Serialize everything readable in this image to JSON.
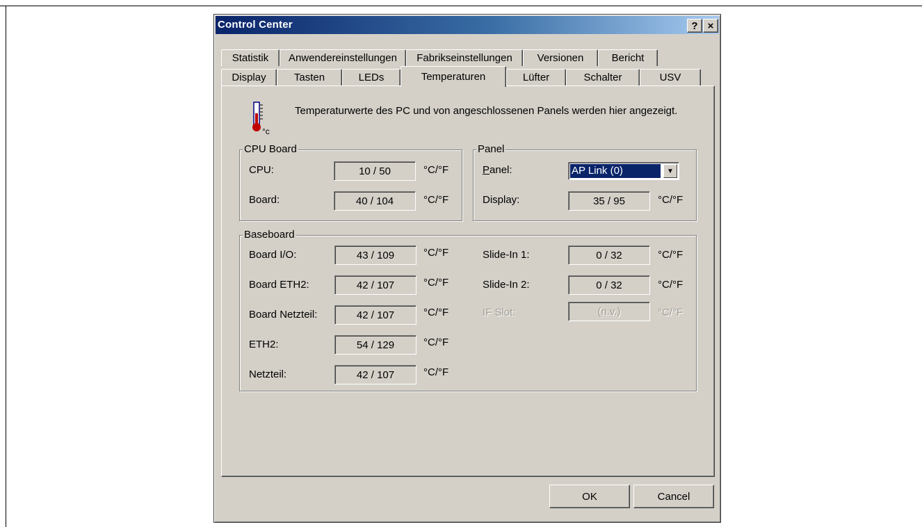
{
  "window": {
    "title": "Control Center",
    "help_glyph": "?",
    "close_glyph": "×"
  },
  "tabs": {
    "row1": [
      "Statistik",
      "Anwendereinstellungen",
      "Fabrikseinstellungen",
      "Versionen",
      "Bericht"
    ],
    "row2": [
      "Display",
      "Tasten",
      "LEDs",
      "Temperaturen",
      "Lüfter",
      "Schalter",
      "USV"
    ],
    "active": "Temperaturen"
  },
  "intro": {
    "icon": "thermometer-icon",
    "icon_unit": "°c",
    "text": "Temperaturwerte des PC und von angeschlossenen Panels werden hier angezeigt."
  },
  "unit_label": "°C/°F",
  "cpu_board": {
    "title": "CPU Board",
    "rows": [
      {
        "label": "CPU:",
        "value": "10 / 50"
      },
      {
        "label": "Board:",
        "value": "40 / 104"
      }
    ]
  },
  "panel": {
    "title": "Panel",
    "panel_label_underlined": "P",
    "panel_label_rest": "anel:",
    "panel_select_value": "AP Link (0)",
    "display_label": "Display:",
    "display_value": "35 / 95"
  },
  "baseboard": {
    "title": "Baseboard",
    "left_rows": [
      {
        "label": "Board I/O:",
        "value": "43 / 109"
      },
      {
        "label": "Board ETH2:",
        "value": "42 / 107"
      },
      {
        "label": "Board Netzteil:",
        "value": "42 / 107"
      },
      {
        "label": "ETH2:",
        "value": "54 / 129"
      },
      {
        "label": "Netzteil:",
        "value": "42 / 107"
      }
    ],
    "right_rows": [
      {
        "label": "Slide-In 1:",
        "value": "0 / 32",
        "disabled": false
      },
      {
        "label": "Slide-In 2:",
        "value": "0 / 32",
        "disabled": false
      },
      {
        "label": "IF Slot:",
        "value": "(n.v.)",
        "disabled": true
      }
    ]
  },
  "buttons": {
    "ok": "OK",
    "cancel": "Cancel"
  },
  "colors": {
    "title_gradient_start": "#0a246a",
    "dialog_face": "#d4d0c8",
    "selection": "#0a246a"
  }
}
